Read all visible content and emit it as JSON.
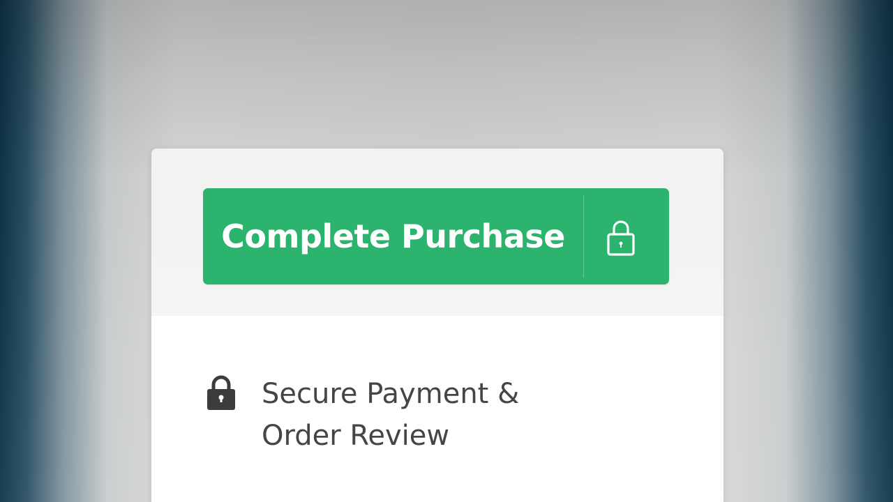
{
  "checkout": {
    "button": {
      "label": "Complete Purchase",
      "icon": "lock-outline-icon",
      "color": "#2cb46e"
    },
    "secure_note": {
      "icon": "lock-icon",
      "line1": "Secure Payment &",
      "line2": "Order Review"
    }
  },
  "colors": {
    "accent": "#2cb46e",
    "text": "#454545",
    "card": "#ffffff"
  }
}
